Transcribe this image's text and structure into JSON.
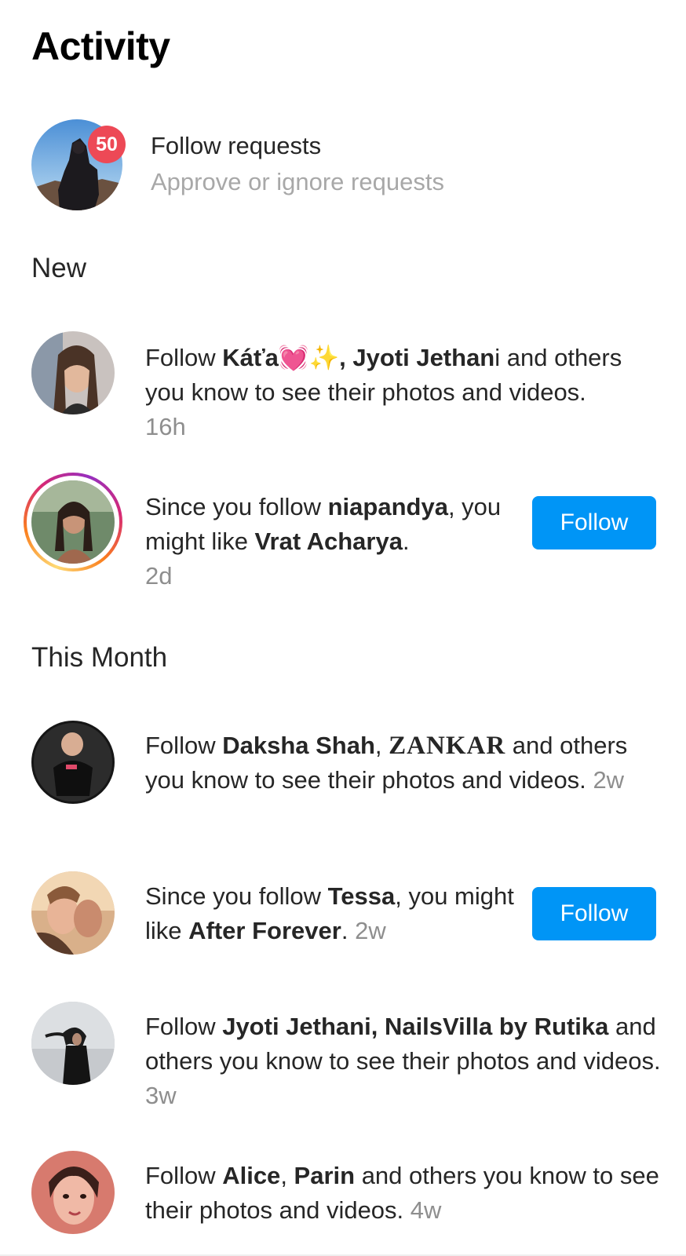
{
  "page": {
    "title": "Activity"
  },
  "follow_requests": {
    "badge_count": "50",
    "title": "Follow requests",
    "subtitle": "Approve or ignore requests"
  },
  "sections": {
    "new": "New",
    "this_month": "This Month"
  },
  "notifications": [
    {
      "prefix": "Follow ",
      "name1": "Káťa",
      "emoji": "💓✨",
      "sep": ", ",
      "name2": "Jyoti Jethan",
      "rest": "i and others you know to see their photos and videos.",
      "time": "16h"
    },
    {
      "prefix": "Since you follow ",
      "name1": "niapandya",
      "mid": ", you might like ",
      "name2": "Vrat Acharya",
      "end": ".",
      "time": "2d",
      "button": "Follow"
    },
    {
      "prefix": "Follow ",
      "name1": "Daksha Shah",
      "sep": ", ",
      "name2": "ZANKAR",
      "rest": " and others you know to see their photos and videos.",
      "time": "2w"
    },
    {
      "prefix": "Since you follow ",
      "name1": "Tessa",
      "mid": ", you might like ",
      "name2": "After Forever",
      "end": ".",
      "time": "2w",
      "button": "Follow"
    },
    {
      "prefix": "Follow ",
      "name1": "Jyoti Jethani",
      "sep": ", ",
      "name2": "NailsVilla by Rutika",
      "rest": " and others you know to see their photos and videos.",
      "time": "3w"
    },
    {
      "prefix": "Follow ",
      "name1": "Alice",
      "sep": ", ",
      "name2": "Parin",
      "rest": " and others you know to see their photos and videos.",
      "time": "4w"
    }
  ],
  "colors": {
    "accent": "#0095f6",
    "badge": "#ed4956",
    "muted": "#8e8e8e"
  }
}
